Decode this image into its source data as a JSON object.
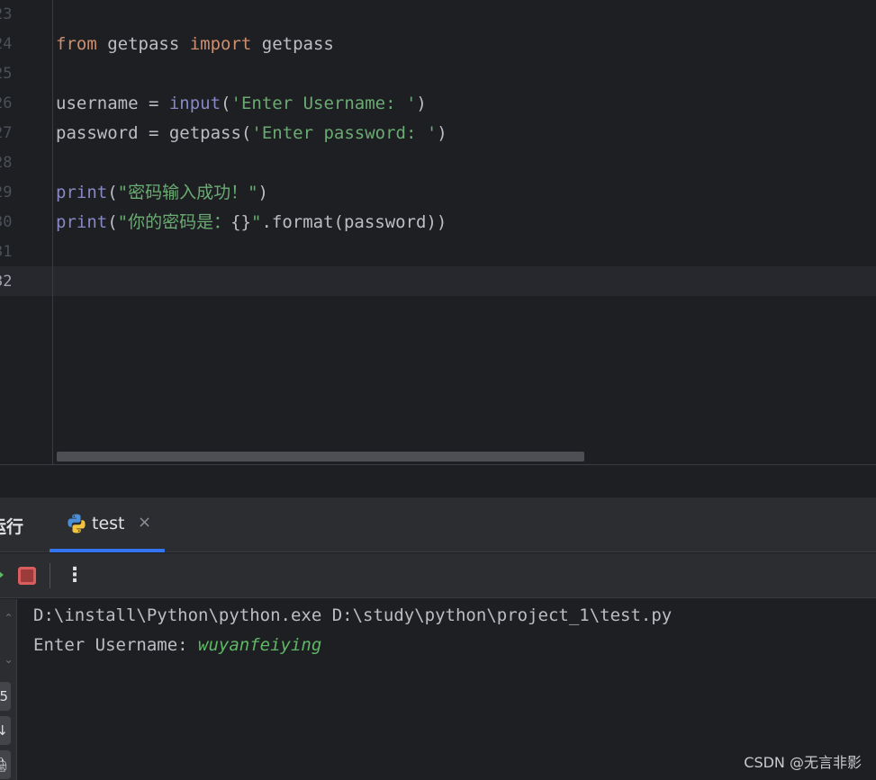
{
  "editor": {
    "line_numbers": [
      "23",
      "24",
      "25",
      "26",
      "27",
      "28",
      "29",
      "30",
      "31",
      "32"
    ],
    "current_line": "32",
    "lines": [
      {
        "tokens": []
      },
      {
        "tokens": [
          {
            "t": "from",
            "c": "kw"
          },
          {
            "t": " getpass ",
            "c": "plain"
          },
          {
            "t": "import",
            "c": "kw"
          },
          {
            "t": " getpass",
            "c": "plain"
          }
        ]
      },
      {
        "tokens": []
      },
      {
        "tokens": [
          {
            "t": "username = ",
            "c": "plain"
          },
          {
            "t": "input",
            "c": "builtin"
          },
          {
            "t": "(",
            "c": "plain"
          },
          {
            "t": "'Enter Username: '",
            "c": "str"
          },
          {
            "t": ")",
            "c": "plain"
          }
        ]
      },
      {
        "tokens": [
          {
            "t": "password = ",
            "c": "plain"
          },
          {
            "t": "getpass",
            "c": "plain"
          },
          {
            "t": "(",
            "c": "plain"
          },
          {
            "t": "'Enter password: '",
            "c": "str"
          },
          {
            "t": ")",
            "c": "plain"
          }
        ]
      },
      {
        "tokens": []
      },
      {
        "tokens": [
          {
            "t": "print",
            "c": "builtin"
          },
          {
            "t": "(",
            "c": "plain"
          },
          {
            "t": "\"密码输入成功！\"",
            "c": "str"
          },
          {
            "t": ")",
            "c": "plain"
          }
        ]
      },
      {
        "tokens": [
          {
            "t": "print",
            "c": "builtin"
          },
          {
            "t": "(",
            "c": "plain"
          },
          {
            "t": "\"你的密码是：",
            "c": "str"
          },
          {
            "t": "{}",
            "c": "plain"
          },
          {
            "t": "\"",
            "c": "str"
          },
          {
            "t": ".format(password))",
            "c": "plain"
          }
        ]
      },
      {
        "tokens": []
      },
      {
        "tokens": []
      }
    ]
  },
  "run_panel": {
    "title": "运行",
    "tab_label": "test",
    "tab_close": "×",
    "more_label": "⋮",
    "console": {
      "command": "D:\\install\\Python\\python.exe D:\\study\\python\\project_1\\test.py",
      "prompt": "Enter Username: ",
      "user_input": "wuyanfeiying"
    },
    "side_buttons": [
      "5",
      "↓",
      "🖨"
    ]
  },
  "watermark": "CSDN @无言非影",
  "colors": {
    "keyword": "#cf8e6d",
    "builtin": "#8888c6",
    "string": "#6aab73",
    "plain": "#bcbec4",
    "accent": "#3574f0",
    "stop": "#db5c5c",
    "user_input": "#5fb865"
  }
}
